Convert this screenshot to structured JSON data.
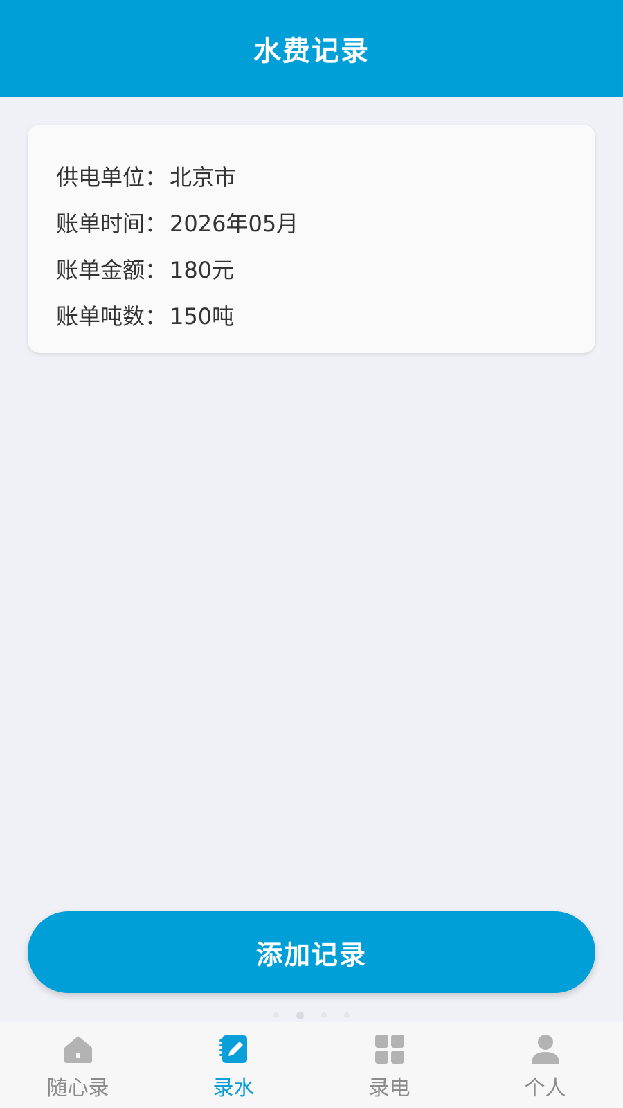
{
  "header": {
    "title": "水费记录"
  },
  "record": {
    "rows": [
      {
        "label": "供电单位：",
        "value": "北京市"
      },
      {
        "label": "账单时间：",
        "value": "2026年05月"
      },
      {
        "label": "账单金额：",
        "value": "180元"
      },
      {
        "label": "账单吨数：",
        "value": "150吨"
      }
    ]
  },
  "add_button": {
    "label": "添加记录"
  },
  "tabbar": {
    "active_index": 1,
    "tabs": [
      {
        "label": "随心录",
        "icon": "home-icon"
      },
      {
        "label": "录水",
        "icon": "edit-note-icon"
      },
      {
        "label": "录电",
        "icon": "grid-icon"
      },
      {
        "label": "个人",
        "icon": "person-icon"
      }
    ]
  },
  "colors": {
    "primary": "#009fd8",
    "background": "#eff1f6",
    "card": "#fafafa",
    "text": "#333333",
    "tab_inactive": "#8c8c8c"
  }
}
